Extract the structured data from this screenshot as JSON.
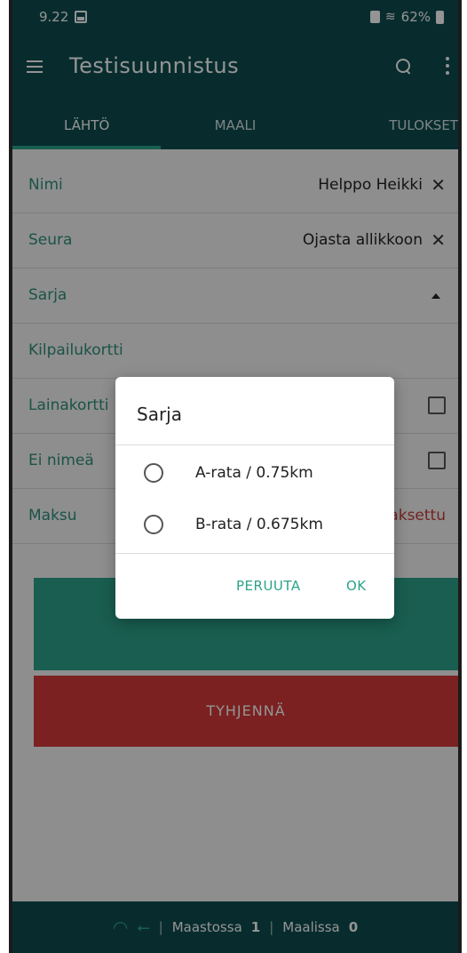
{
  "status_bar": {
    "time": "9.22",
    "battery": "62%"
  },
  "toolbar": {
    "title": "Testisuunnistus"
  },
  "tabs": [
    {
      "label": "LÄHTÖ",
      "active": true
    },
    {
      "label": "MAALI",
      "active": false
    },
    {
      "label": "TULOKSET",
      "active": false
    }
  ],
  "form": {
    "name_label": "Nimi",
    "name_value": "Helppo Heikki",
    "club_label": "Seura",
    "club_value": "Ojasta allikkoon",
    "class_label": "Sarja",
    "card_label": "Kilpailukortti",
    "loan_label": "Lainakortti",
    "noname_label": "Ei nimeä",
    "payment_label": "Maksu",
    "payment_status": "Maksettu"
  },
  "buttons": {
    "save": "",
    "clear": "TYHJENNÄ"
  },
  "bottom_bar": {
    "in_forest_label": "Maastossa",
    "in_forest_count": "1",
    "finished_label": "Maalissa",
    "finished_count": "0"
  },
  "dialog": {
    "title": "Sarja",
    "options": [
      {
        "label": "A-rata / 0.75km",
        "selected": false
      },
      {
        "label": "B-rata / 0.675km",
        "selected": false
      }
    ],
    "cancel": "PERUUTA",
    "ok": "OK"
  },
  "colors": {
    "primary_dark": "#0f4d50",
    "accent": "#2ba38a",
    "danger": "#d43a3a"
  }
}
